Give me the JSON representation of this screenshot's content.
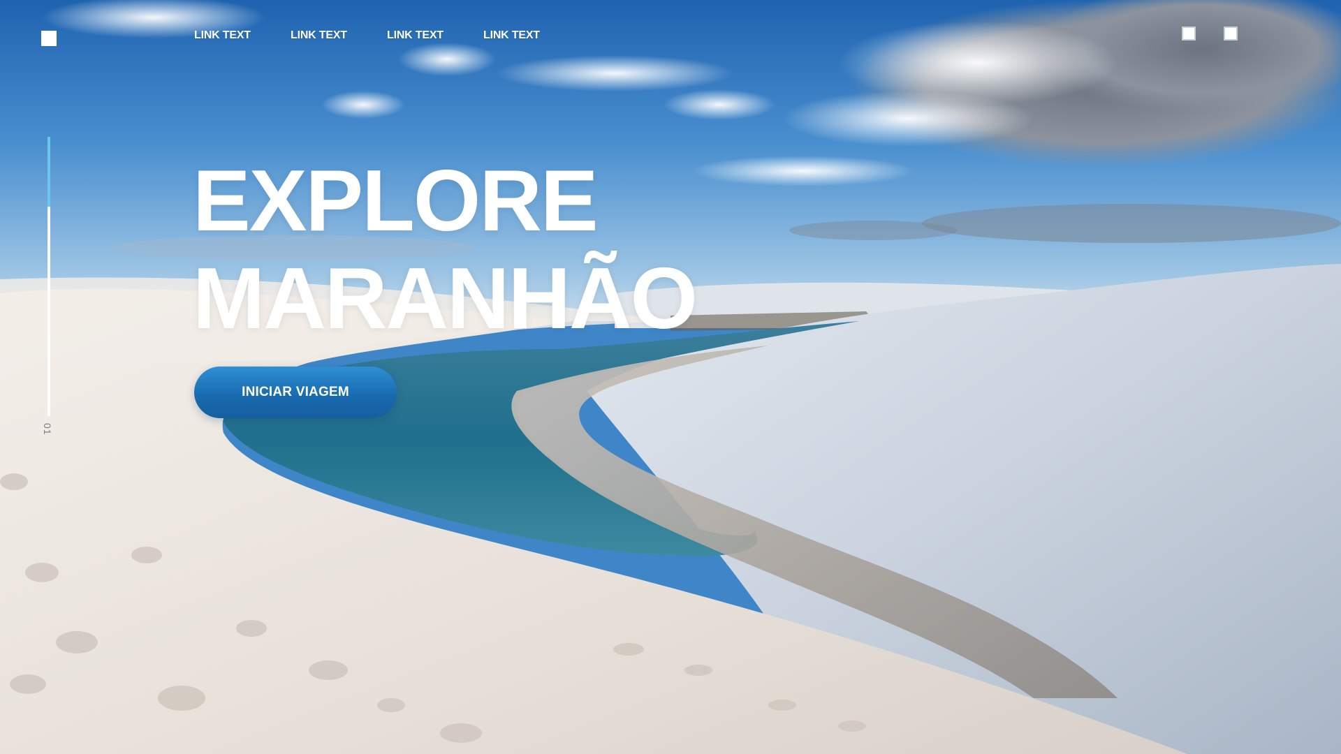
{
  "header": {
    "nav_links": [
      {
        "label": "LINK TEXT"
      },
      {
        "label": "LINK TEXT"
      },
      {
        "label": "LINK TEXT"
      },
      {
        "label": "LINK TEXT"
      }
    ]
  },
  "hero": {
    "title_line_1": "EXPLORE",
    "title_line_2": "MARANHÃO",
    "cta_label": "INICIAR VIAGEM"
  },
  "slider": {
    "slide_number": "01",
    "progress_fraction": 0.25
  },
  "colors": {
    "sky_top": "#2f6fb8",
    "accent_blue": "#1b72b8",
    "progress_fill": "#6cc5ee",
    "lagoon": "#2f7fa0",
    "sand": "#ece8e4"
  }
}
